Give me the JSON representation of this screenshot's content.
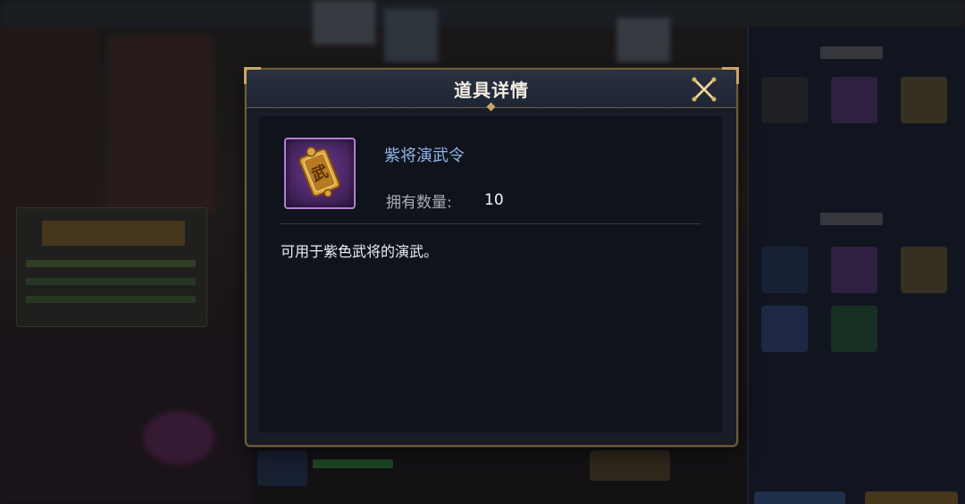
{
  "dialog": {
    "title": "道具详情",
    "close_icon": "close-icon"
  },
  "item": {
    "name": "紫将演武令",
    "icon": "wu-token-icon",
    "icon_glyph": "武",
    "quantity_label": "拥有数量:",
    "quantity_value": "10",
    "description": "可用于紫色武将的演武。",
    "rarity_color": "#b47fd4"
  },
  "colors": {
    "frame_gold": "#c8a665",
    "name_blue": "#8fb4e6",
    "panel_bg": "#171c27"
  }
}
